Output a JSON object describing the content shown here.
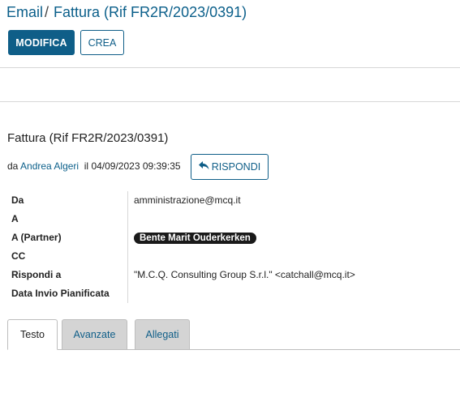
{
  "breadcrumb": {
    "root": "Email",
    "separator": "/",
    "current": "Fattura (Rif FR2R/2023/0391)"
  },
  "toolbar": {
    "edit_label": "MODIFICA",
    "create_label": "CREA"
  },
  "message": {
    "subject": "Fattura (Rif FR2R/2023/0391)",
    "by_prefix": "da",
    "author": "Andrea Algeri",
    "date_prefix": "il",
    "date": "04/09/2023 09:39:35",
    "reply_label": "RISPONDI",
    "reply_icon": "reply-icon"
  },
  "fields": [
    {
      "label": "Da",
      "value": "amministrazione@mcq.it"
    },
    {
      "label": "A",
      "value": ""
    },
    {
      "label": "A (Partner)",
      "value": "Bente Marit Ouderkerken"
    },
    {
      "label": "CC",
      "value": ""
    },
    {
      "label": "Rispondi a",
      "value": "\"M.C.Q. Consulting Group S.r.l.\" <catchall@mcq.it>"
    },
    {
      "label": "Data Invio Pianificata",
      "value": ""
    }
  ],
  "tabs": [
    {
      "label": "Testo",
      "active": true
    },
    {
      "label": "Avanzate",
      "active": false
    },
    {
      "label": "Allegati",
      "active": false
    }
  ],
  "colors": {
    "primary": "#0f5e88",
    "link": "#0b5f8a",
    "tab_inactive_bg": "#d4d4d4",
    "badge_bg": "#1a1a1a"
  }
}
